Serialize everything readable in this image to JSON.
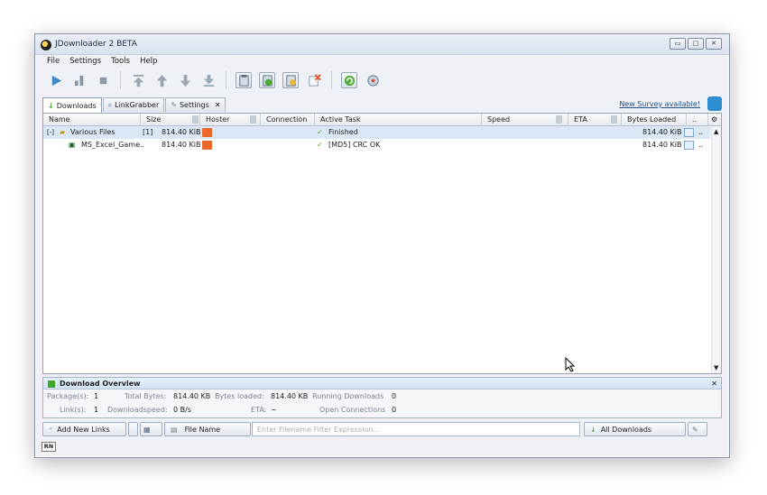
{
  "window": {
    "title": "JDownloader 2 BETA",
    "controls": {
      "minimize": "▭",
      "maximize": "□",
      "close": "✕"
    }
  },
  "menu": {
    "items": [
      "File",
      "Settings",
      "Tools",
      "Help"
    ]
  },
  "toolbar": {
    "buttons": [
      "play-icon",
      "pause-icon",
      "stop-icon",
      "move-top-icon",
      "move-up-icon",
      "move-down-icon",
      "move-bottom-icon",
      "clipboard-icon",
      "auto-reconnect-icon",
      "premium-icon",
      "clear-icon",
      "update-icon",
      "reconnect-icon"
    ]
  },
  "tabs": [
    {
      "label": "Downloads",
      "icon": "download-arrow-icon",
      "active": true
    },
    {
      "label": "LinkGrabber",
      "icon": "linkgrabber-icon",
      "active": false
    },
    {
      "label": "Settings",
      "icon": "settings-icon",
      "active": false,
      "close": "✕"
    }
  ],
  "survey": {
    "label": "New Survey available!"
  },
  "table": {
    "columns": {
      "name": "Name",
      "size": "Size",
      "hoster": "Hoster",
      "connection": "Connection",
      "active_task": "Active Task",
      "speed": "Speed",
      "eta": "ETA",
      "bytes_loaded": "Bytes Loaded",
      "more": ".."
    },
    "rows": [
      {
        "expander": "[-]",
        "name": "Various Files",
        "count": "[1]",
        "size": "814.40 KiB",
        "task_icon": "✓",
        "active_task": "Finished",
        "bytes_loaded": "814.40 KiB",
        "more": ".."
      },
      {
        "name": "MS_Excel_Game..",
        "size": "814.40 KiB",
        "task_icon": "✓",
        "active_task": "[MD5] CRC OK",
        "bytes_loaded": "814.40 KiB",
        "more": ".."
      }
    ]
  },
  "overview": {
    "title": "Download Overview",
    "packages_label": "Package(s):",
    "packages_value": "1",
    "total_bytes_label": "Total Bytes:",
    "total_bytes_value": "814.40 KB",
    "bytes_loaded_label": "Bytes loaded:",
    "bytes_loaded_value": "814.40 KB",
    "running_downloads_label": "Running Downloads",
    "running_downloads_value": "0",
    "links_label": "Link(s):",
    "links_value": "1",
    "download_speed_label": "Downloadspeed:",
    "download_speed_value": "0 B/s",
    "eta_label": "ETA:",
    "eta_value": "~",
    "open_connections_label": "Open Connections",
    "open_connections_value": "0",
    "close": "✕"
  },
  "bottom": {
    "add_new_links": "Add New Links",
    "file_name": "File Name",
    "filter_placeholder": "Enter Filename Filter Expression...",
    "all_downloads": "All Downloads"
  },
  "status": {
    "badge": "RN"
  }
}
